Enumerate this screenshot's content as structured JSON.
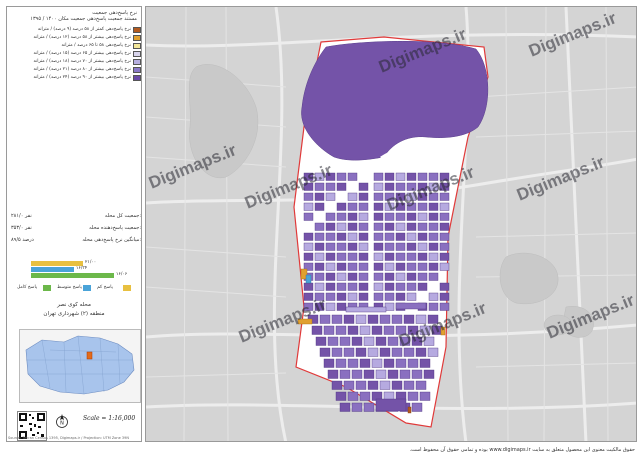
{
  "legend": {
    "title_line1": "نرخ پاسخ‌دهی جمعیت",
    "title_line2": "مستند جمعیت پاسخ‌دهی جمعیت مکان ۱۴۰۰ / ۱۳۹۵",
    "items": [
      {
        "label": "نرخ پاسخ‌دهی کمتر از ۵۸ درصد (۹ درصد) / مترانه",
        "color": "#b35a1f"
      },
      {
        "label": "نرخ پاسخ‌دهی بیشتر از ۵۸ درصد (۱۲ درصد) / مترانه",
        "color": "#e0a030"
      },
      {
        "label": "نرخ پاسخ‌دهی ۵۸ تا ۶۵ درصد / مترانه",
        "color": "#f3e79a"
      },
      {
        "label": "نرخ پاسخ‌دهی بیشتر از ۶۵ درصد (۱۵ درصد) / مترانه",
        "color": "#d8d4ec"
      },
      {
        "label": "نرخ پاسخ‌دهی بیشتر از ۷۰ درصد (۱۸ درصد) / مترانه",
        "color": "#b6aee0"
      },
      {
        "label": "نرخ پاسخ‌دهی بیشتر از ۸۰ درصد (۲۱ درصد) / مترانه",
        "color": "#8a78c8"
      },
      {
        "label": "نرخ پاسخ‌دهی بیشتر از ۹۰ درصد (۲۴ درصد) / مترانه",
        "color": "#6a4aa8"
      }
    ]
  },
  "stats": [
    {
      "key": "جمعیت کل محله:",
      "value": "۲۸۱/۰ نفر"
    },
    {
      "key": "جمعیت پاسخ‌دهنده محله:",
      "value": "۳۵۳/۰ نفر"
    },
    {
      "key": "میانگین نرخ پاسخ‌دهی محله:",
      "value": "۸۹/۵ درصد"
    }
  ],
  "bars": [
    {
      "label": "۲۱/۰۰",
      "color": "#e8c040",
      "value": 0.58
    },
    {
      "label": "۱۶/۳۴",
      "color": "#4aa3d8",
      "value": 0.48
    },
    {
      "label": "۱۶/۰۶",
      "color": "#6cb84a",
      "value": 0.92
    }
  ],
  "chips": [
    {
      "label": "پاسخ کم",
      "color": "#e8c040"
    },
    {
      "label": "پاسخ متوسط",
      "color": "#4aa3d8"
    },
    {
      "label": "پاسخ کامل",
      "color": "#6cb84a"
    }
  ],
  "location": {
    "title": "محله کوی نصر",
    "subtitle": "منطقه (۲) شهرداری تهران"
  },
  "scale": "Scale = 1:16,000",
  "footer_left": "Source: Tehran Census 1395, Digimaps.ir / Projection: UTM Zone 39N",
  "footer_right": "حقوق مالکیت معنوی این محصول متعلق به سایت www.digimaps.ir بوده و تمامی حقوق آن محفوظ است.",
  "watermark": "Digimaps.ir",
  "colors": {
    "purple_dark": "#7453a8",
    "purple_mid": "#8a70c0",
    "purple_light": "#b6aae0",
    "boundary": "#e03a3a",
    "map_bg": "#d4d4d4"
  }
}
